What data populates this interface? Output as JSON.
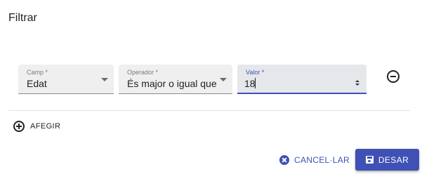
{
  "dialog": {
    "title": "Filtrar"
  },
  "filter_row": {
    "field": {
      "label": "Camp *",
      "value": "Edat"
    },
    "operator": {
      "label": "Operador *",
      "value": "És major o igual que"
    },
    "value": {
      "label": "Valor *",
      "value": "18"
    }
  },
  "actions": {
    "add_label": "AFEGIR",
    "cancel_label": "CANCEL·LAR",
    "save_label": "DESAR"
  },
  "icons": {
    "remove": "minus-circle-icon",
    "add": "plus-circle-icon",
    "cancel": "cancel-icon",
    "save": "floppy-disk-icon",
    "dropdown": "triangle-down-icon",
    "spinner": "number-spinner-icon"
  },
  "colors": {
    "primary": "#3f51b5"
  }
}
